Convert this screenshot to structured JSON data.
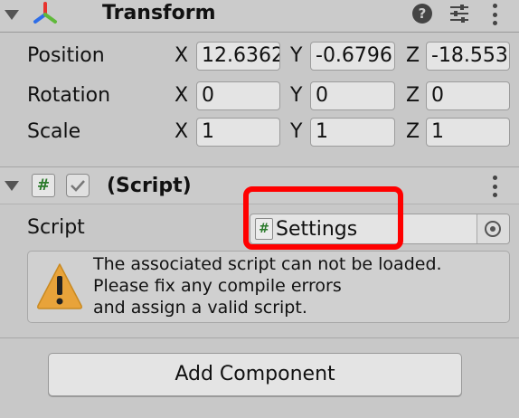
{
  "transform": {
    "title": "Transform",
    "rows": [
      {
        "label": "Position",
        "x_axis": "X",
        "y_axis": "Y",
        "z_axis": "Z",
        "x": "12.6362",
        "y": "-0.6796",
        "z": "-18.553"
      },
      {
        "label": "Rotation",
        "x_axis": "X",
        "y_axis": "Y",
        "z_axis": "Z",
        "x": "0",
        "y": "0",
        "z": "0"
      },
      {
        "label": "Scale",
        "x_axis": "X",
        "y_axis": "Y",
        "z_axis": "Z",
        "x": "1",
        "y": "1",
        "z": "1"
      }
    ]
  },
  "script_component": {
    "title": "(Script)",
    "hash_glyph": "#",
    "script_label": "Script",
    "script_value": "Settings",
    "warning_lines": [
      "The associated script can not be loaded.",
      "Please fix any compile errors",
      "and assign a valid script."
    ]
  },
  "add_component_label": "Add Component",
  "colors": {
    "highlight": "#ff0000",
    "warning_icon": "#e8a33a",
    "axis_red": "#e8332e",
    "axis_green": "#5fb93a",
    "axis_blue": "#2e6ee8"
  }
}
